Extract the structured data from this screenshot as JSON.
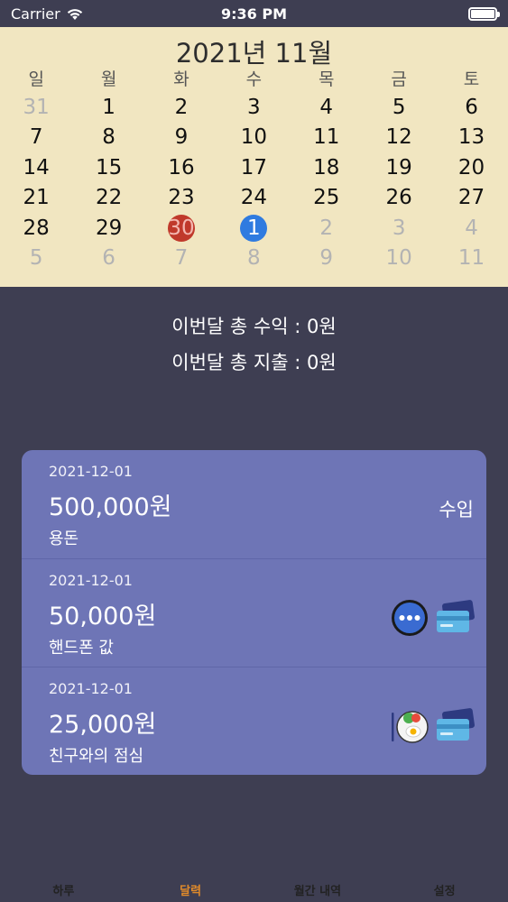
{
  "status": {
    "carrier": "Carrier",
    "time": "9:36 PM"
  },
  "calendar": {
    "title": "2021년 11월",
    "weekdays": [
      "일",
      "월",
      "화",
      "수",
      "목",
      "금",
      "토"
    ],
    "weeks": [
      [
        "31",
        "1",
        "2",
        "3",
        "4",
        "5",
        "6"
      ],
      [
        "7",
        "8",
        "9",
        "10",
        "11",
        "12",
        "13"
      ],
      [
        "14",
        "15",
        "16",
        "17",
        "18",
        "19",
        "20"
      ],
      [
        "21",
        "22",
        "23",
        "24",
        "25",
        "26",
        "27"
      ],
      [
        "28",
        "29",
        "30",
        "1",
        "2",
        "3",
        "4"
      ],
      [
        "5",
        "6",
        "7",
        "8",
        "9",
        "10",
        "11"
      ]
    ],
    "today_color": "#c0392b",
    "selected_color": "#2f7be0"
  },
  "summary": {
    "income": "이번달 총 수익 : 0원",
    "expense": "이번달 총 지출 : 0원"
  },
  "transactions": [
    {
      "date": "2021-12-01",
      "amount": "500,000원",
      "memo": "용돈",
      "type": "수입",
      "icons": []
    },
    {
      "date": "2021-12-01",
      "amount": "50,000원",
      "memo": "핸드폰 값",
      "type": "",
      "icons": [
        "more-icon",
        "credit-card-icon"
      ]
    },
    {
      "date": "2021-12-01",
      "amount": "25,000원",
      "memo": "친구와의 점심",
      "type": "",
      "icons": [
        "food-icon",
        "credit-card-icon"
      ]
    }
  ],
  "tabs": [
    {
      "label": "하루",
      "active": false
    },
    {
      "label": "달력",
      "active": true
    },
    {
      "label": "월간 내역",
      "active": false
    },
    {
      "label": "설정",
      "active": false
    }
  ],
  "colors": {
    "accent": "#e08a2a",
    "card": "#6e75b6",
    "calendar_bg": "#f1e6c1",
    "bg": "#3e3e52"
  }
}
